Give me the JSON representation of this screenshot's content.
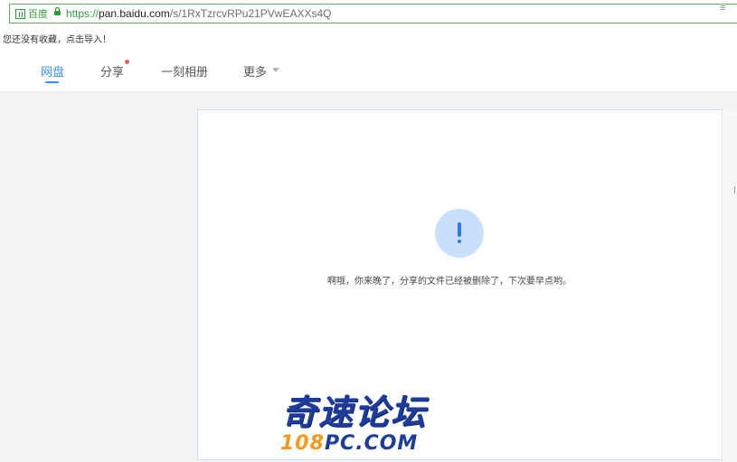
{
  "browser": {
    "site_badge": "百度",
    "url_scheme": "https://",
    "url_host": "pan.baidu.com",
    "url_path": "/s/1RxTzrcvRPu21PVwEAXXs4Q",
    "right_icon": "≡",
    "bookmarks_hint": "您还没有收藏，点击导入！",
    "accent": "#2e9b3e"
  },
  "nav": {
    "items": [
      {
        "label": "网盘",
        "active": true
      },
      {
        "label": "分享",
        "badge": true
      },
      {
        "label": "一刻相册"
      },
      {
        "label": "更多"
      }
    ],
    "accent": "#3b8cff"
  },
  "main": {
    "alert_icon": "exclamation-icon",
    "message": "啊哦，你来晚了，分享的文件已经被删除了，下次要早点哟。"
  },
  "watermark": {
    "cn": "奇速论坛",
    "en_orange": "108",
    "en_blue": "PC.COM"
  }
}
